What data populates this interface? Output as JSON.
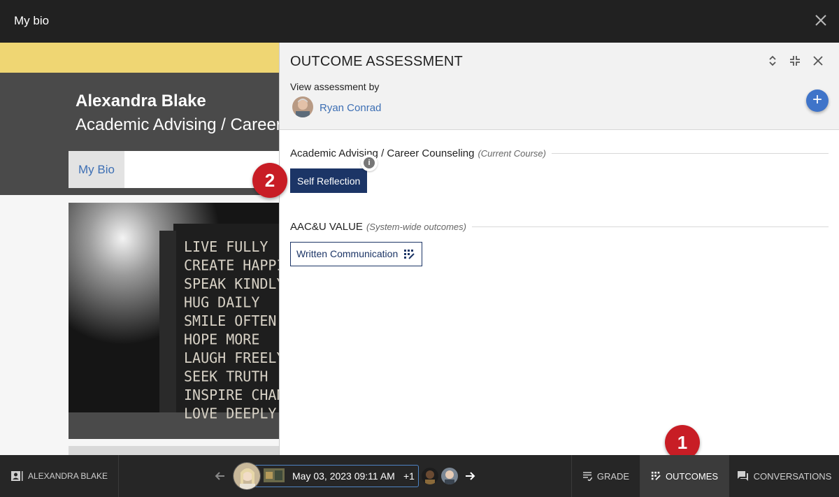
{
  "window": {
    "title": "My bio"
  },
  "background": {
    "user_name": "Alexandra Blake",
    "course_name": "Academic Advising / Career Counseling",
    "tab_label": "My Bio",
    "poster_lines": [
      "LIVE FULLY",
      "CREATE HAPPI",
      "SPEAK KINDLY",
      "HUG DAILY",
      "SMILE OFTEN",
      "HOPE MORE",
      "LAUGH FREELY",
      "SEEK TRUTH",
      "INSPIRE CHAN",
      "LOVE DEEPLY"
    ]
  },
  "panel": {
    "title": "OUTCOME ASSESSMENT",
    "view_by_label": "View assessment by",
    "assessor_name": "Ryan Conrad",
    "add_label": "+",
    "sections": [
      {
        "title": "Academic Advising / Career Counseling",
        "subtitle": "(Current Course)",
        "button": "Self Reflection"
      },
      {
        "title": "AAC&U VALUE",
        "subtitle": "(System-wide outcomes)",
        "button": "Written Communication"
      }
    ],
    "info_glyph": "i"
  },
  "markers": {
    "one": "1",
    "two": "2"
  },
  "bottom": {
    "student_label": "ALEXANDRA BLAKE",
    "submission_date": "May 03, 2023 09:11 AM",
    "extra_count": "+1",
    "tools": {
      "grade": "GRADE",
      "outcomes": "OUTCOMES",
      "conversations": "CONVERSATIONS"
    }
  },
  "colors": {
    "accent_blue": "#3f74c9",
    "navy": "#1c3566",
    "marker_red": "#c81d25",
    "yellow_band": "#efd673"
  },
  "icons": [
    "close-icon",
    "expand-icon",
    "collapse-icon",
    "info-icon",
    "outcome-grid-icon",
    "arrow-left-icon",
    "arrow-right-icon",
    "grade-icon",
    "conversations-icon",
    "student-card-icon"
  ]
}
